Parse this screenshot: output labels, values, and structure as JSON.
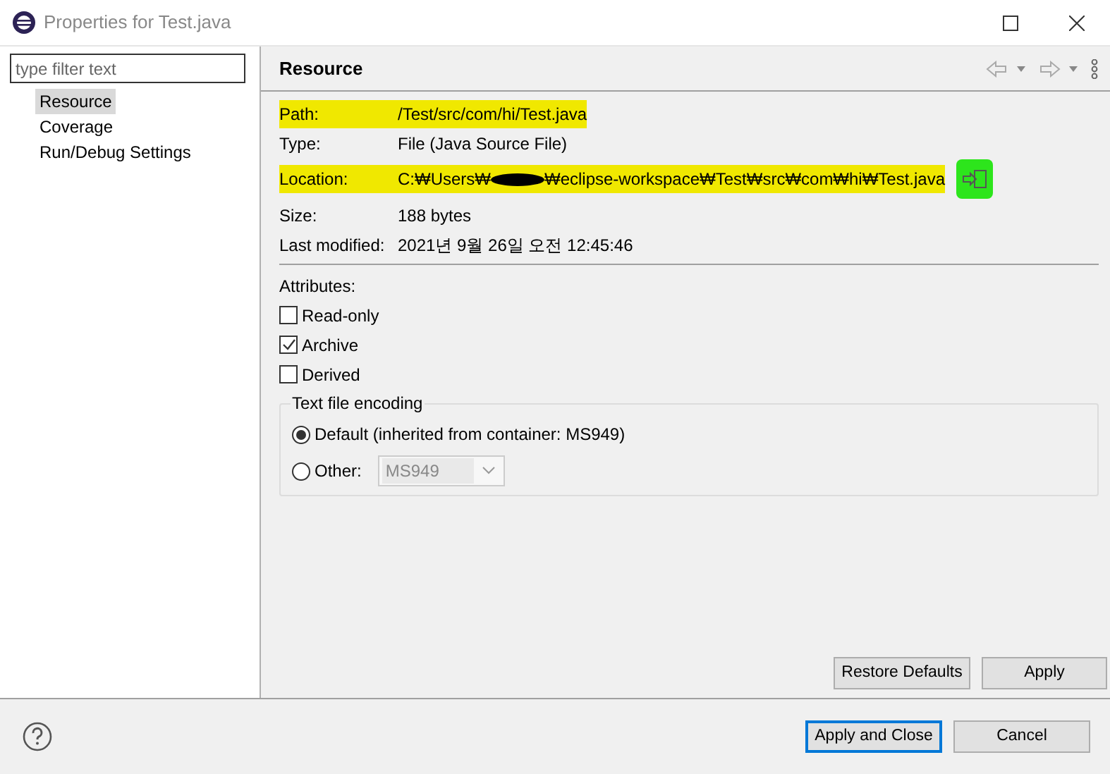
{
  "window": {
    "title": "Properties for Test.java"
  },
  "filter": {
    "placeholder": "type filter text"
  },
  "sidebar": {
    "items": [
      {
        "label": "Resource",
        "selected": true
      },
      {
        "label": "Coverage",
        "selected": false
      },
      {
        "label": "Run/Debug Settings",
        "selected": false
      }
    ]
  },
  "page": {
    "title": "Resource",
    "properties": [
      {
        "kind": "plain",
        "label": "Path:",
        "value": "/Test/src/com/hi/Test.java",
        "highlighted": true
      },
      {
        "kind": "plain",
        "label": "Type:",
        "value": "File  (Java Source File)",
        "highlighted": false
      },
      {
        "kind": "redacted",
        "label": "Location:",
        "value": "C:₩Users₩",
        "value_after": "₩eclipse-workspace₩Test₩src₩com₩hi₩Test.java",
        "highlighted": true
      },
      {
        "kind": "plain",
        "label": "Size:",
        "value": "188  bytes",
        "highlighted": false
      },
      {
        "kind": "plain",
        "label": "Last modified:",
        "value": "2021년 9월 26일 오전 12:45:46",
        "highlighted": false
      }
    ],
    "attributes_label": "Attributes:",
    "attributes": [
      {
        "label": "Read-only",
        "checked": false
      },
      {
        "label": "Archive",
        "checked": true
      },
      {
        "label": "Derived",
        "checked": false
      }
    ],
    "encoding": {
      "title": "Text file encoding",
      "options": [
        {
          "kind": "default",
          "label": "Default (inherited from container: MS949)",
          "selected": true
        },
        {
          "kind": "other",
          "label": "Other:",
          "selected": false,
          "combo_value": "MS949"
        }
      ]
    },
    "buttons": [
      "Restore Defaults",
      "Apply"
    ]
  },
  "footer": {
    "buttons": [
      {
        "label": "Apply and Close",
        "default": true
      },
      {
        "label": "Cancel",
        "default": false
      }
    ]
  }
}
